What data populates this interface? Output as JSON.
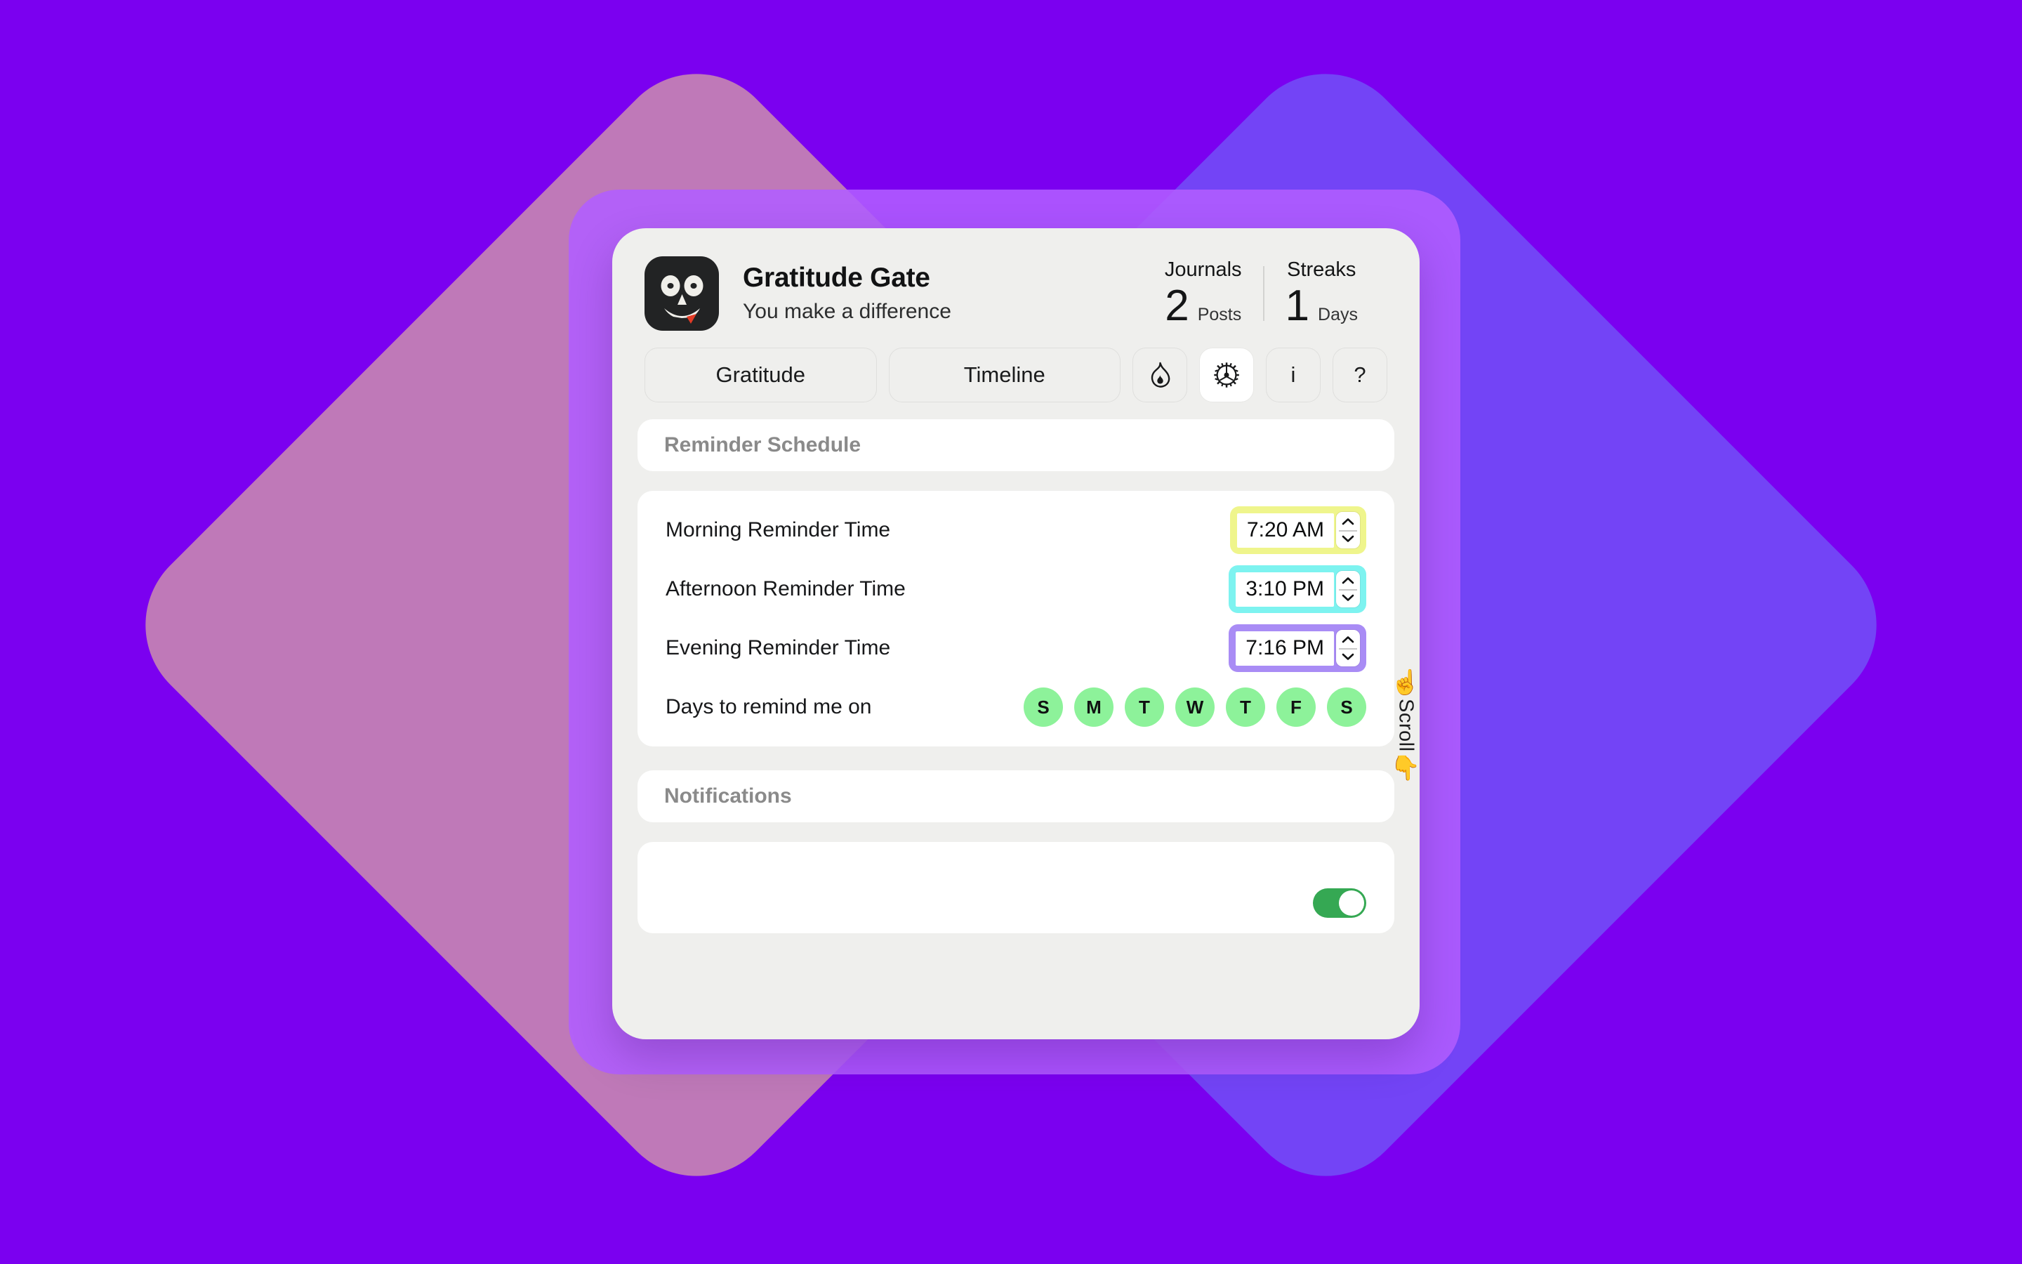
{
  "background": {
    "base_color": "#7B00F0",
    "shapes": [
      {
        "name": "tan-rotated-square",
        "color": "#E8C496"
      },
      {
        "name": "blue-rotated-square",
        "color": "#6E6EFA"
      },
      {
        "name": "card-backplate",
        "color": "#B25DFF"
      }
    ]
  },
  "header": {
    "app_icon_name": "skull-face-icon",
    "title": "Gratitude Gate",
    "tagline": "You make a difference",
    "stats": [
      {
        "label": "Journals",
        "value": "2",
        "unit": "Posts"
      },
      {
        "label": "Streaks",
        "value": "1",
        "unit": "Days"
      }
    ]
  },
  "tabs": [
    {
      "label": "Gratitude",
      "icon": "",
      "active": false,
      "type": "text"
    },
    {
      "label": "Timeline",
      "icon": "",
      "active": false,
      "type": "text"
    },
    {
      "label": "",
      "icon": "flame-icon",
      "active": false,
      "type": "icon"
    },
    {
      "label": "",
      "icon": "gear-icon",
      "active": true,
      "type": "icon"
    },
    {
      "label": "i",
      "icon": "info-icon",
      "active": false,
      "type": "icon-text"
    },
    {
      "label": "?",
      "icon": "question-mark-icon",
      "active": false,
      "type": "icon-text"
    }
  ],
  "sections": {
    "reminder_schedule": {
      "title": "Reminder Schedule",
      "rows": [
        {
          "label": "Morning Reminder Time",
          "value": "7:20 AM",
          "accent": "#EFF58C"
        },
        {
          "label": "Afternoon Reminder Time",
          "value": "3:10 PM",
          "accent": "#7DF3F0"
        },
        {
          "label": "Evening Reminder Time",
          "value": "7:16 PM",
          "accent": "#A98CF5"
        }
      ],
      "days_label": "Days to remind me on",
      "days": [
        {
          "letter": "S",
          "selected": true
        },
        {
          "letter": "M",
          "selected": true
        },
        {
          "letter": "T",
          "selected": true
        },
        {
          "letter": "W",
          "selected": true
        },
        {
          "letter": "T",
          "selected": true
        },
        {
          "letter": "F",
          "selected": true
        },
        {
          "letter": "S",
          "selected": true
        }
      ],
      "day_selected_color": "#8DF29A"
    },
    "notifications": {
      "title": "Notifications",
      "toggle_color": "#35A853",
      "toggle_on": true
    }
  },
  "scroll_hint": {
    "label": "Scroll",
    "up_icon": "pointing-up-finger-icon",
    "down_icon": "pointing-down-finger-icon",
    "up_glyph": "☝",
    "down_glyph": "👇"
  }
}
